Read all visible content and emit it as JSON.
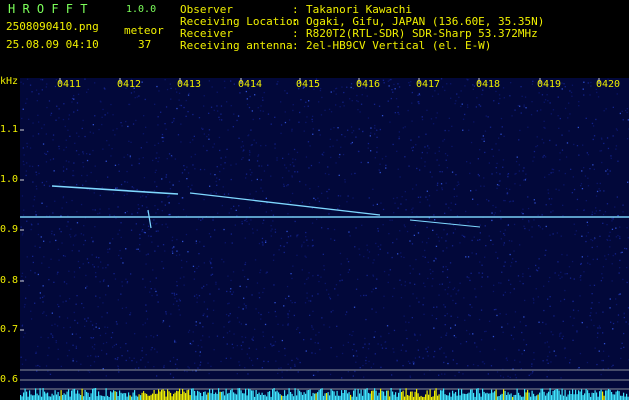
{
  "header": {
    "brand": "H R O F F T",
    "version": "1.0.0",
    "filename": "2508090410.png",
    "datetime": "25.08.09 04:10",
    "meteor_label": "meteor",
    "meteor_count": "37",
    "info": [
      {
        "label": "Observer",
        "sep": ":",
        "value": "Takanori Kawachi"
      },
      {
        "label": "Receiving Location",
        "sep": ":",
        "value": "Ogaki, Gifu, JAPAN (136.60E, 35.35N)"
      },
      {
        "label": "Receiver",
        "sep": ":",
        "value": "R820T2(RTL-SDR) SDR-Sharp 53.372MHz"
      },
      {
        "label": "Receiving antenna",
        "sep": ":",
        "value": "2el-HB9CV Vertical (el. E-W)"
      }
    ]
  },
  "spectrogram": {
    "y_unit": "kHz",
    "y_ticks": [
      "1.1",
      "1.0",
      "0.9",
      "0.8",
      "0.7",
      "0.6"
    ],
    "x_ticks": [
      "0411",
      "0412",
      "0413",
      "0414",
      "0415",
      "0416",
      "0417",
      "0418",
      "0419",
      "0420"
    ],
    "colors": {
      "background": "#02083a",
      "signal": "#7fd8ff",
      "bars_cyan": "#3fe6ff",
      "bars_yellow": "#f0f000"
    }
  }
}
